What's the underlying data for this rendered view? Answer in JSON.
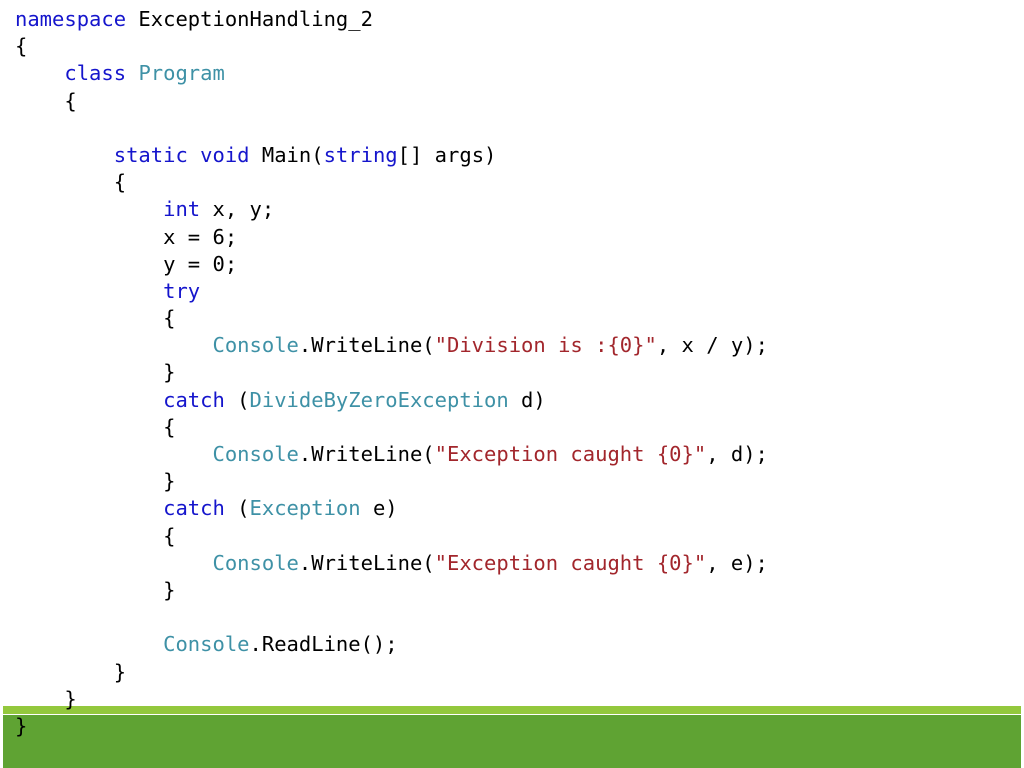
{
  "slide": {
    "kind": "code-slide",
    "background_color": "#FFFFFF",
    "footer": {
      "accent_color": "#93C83D",
      "main_color": "#5FA333"
    }
  },
  "syntax_colors": {
    "keyword": "#1515CC",
    "type": "#3E91A6",
    "string": "#A2262C",
    "plain": "#000000"
  },
  "code": {
    "language": "C#",
    "lines": [
      {
        "id": "l1",
        "indent": 0,
        "tokens": [
          {
            "t": "namespace",
            "c": "kw"
          },
          {
            "t": " ExceptionHandling_2",
            "c": "pl"
          }
        ]
      },
      {
        "id": "l2",
        "indent": 0,
        "tokens": [
          {
            "t": "{",
            "c": "pl"
          }
        ]
      },
      {
        "id": "l3",
        "indent": 1,
        "tokens": [
          {
            "t": "class",
            "c": "kw"
          },
          {
            "t": " ",
            "c": "pl"
          },
          {
            "t": "Program",
            "c": "type"
          }
        ]
      },
      {
        "id": "l4",
        "indent": 1,
        "tokens": [
          {
            "t": "{",
            "c": "pl"
          }
        ]
      },
      {
        "id": "l5",
        "indent": 0,
        "tokens": [
          {
            "t": "",
            "c": "pl"
          }
        ]
      },
      {
        "id": "l6",
        "indent": 2,
        "tokens": [
          {
            "t": "static void",
            "c": "kw"
          },
          {
            "t": " Main(",
            "c": "pl"
          },
          {
            "t": "string",
            "c": "kw"
          },
          {
            "t": "[] args)",
            "c": "pl"
          }
        ]
      },
      {
        "id": "l7",
        "indent": 2,
        "tokens": [
          {
            "t": "{",
            "c": "pl"
          }
        ]
      },
      {
        "id": "l8",
        "indent": 3,
        "tokens": [
          {
            "t": "int",
            "c": "kw"
          },
          {
            "t": " x, y;",
            "c": "pl"
          }
        ]
      },
      {
        "id": "l9",
        "indent": 3,
        "tokens": [
          {
            "t": "x = 6;",
            "c": "pl"
          }
        ]
      },
      {
        "id": "l10",
        "indent": 3,
        "tokens": [
          {
            "t": "y = 0;",
            "c": "pl"
          }
        ]
      },
      {
        "id": "l11",
        "indent": 3,
        "tokens": [
          {
            "t": "try",
            "c": "kw"
          }
        ]
      },
      {
        "id": "l12",
        "indent": 3,
        "tokens": [
          {
            "t": "{",
            "c": "pl"
          }
        ]
      },
      {
        "id": "l13",
        "indent": 4,
        "tokens": [
          {
            "t": "Console",
            "c": "type"
          },
          {
            "t": ".WriteLine(",
            "c": "pl"
          },
          {
            "t": "\"Division is :{0}\"",
            "c": "str"
          },
          {
            "t": ", x / y);",
            "c": "pl"
          }
        ]
      },
      {
        "id": "l14",
        "indent": 3,
        "tokens": [
          {
            "t": "}",
            "c": "pl"
          }
        ]
      },
      {
        "id": "l15",
        "indent": 3,
        "tokens": [
          {
            "t": "catch",
            "c": "kw"
          },
          {
            "t": " (",
            "c": "pl"
          },
          {
            "t": "DivideByZeroException",
            "c": "type"
          },
          {
            "t": " d)",
            "c": "pl"
          }
        ]
      },
      {
        "id": "l16",
        "indent": 3,
        "tokens": [
          {
            "t": "{",
            "c": "pl"
          }
        ]
      },
      {
        "id": "l17",
        "indent": 4,
        "tokens": [
          {
            "t": "Console",
            "c": "type"
          },
          {
            "t": ".WriteLine(",
            "c": "pl"
          },
          {
            "t": "\"Exception caught {0}\"",
            "c": "str"
          },
          {
            "t": ", d);",
            "c": "pl"
          }
        ]
      },
      {
        "id": "l18",
        "indent": 3,
        "tokens": [
          {
            "t": "}",
            "c": "pl"
          }
        ]
      },
      {
        "id": "l19",
        "indent": 3,
        "tokens": [
          {
            "t": "catch",
            "c": "kw"
          },
          {
            "t": " (",
            "c": "pl"
          },
          {
            "t": "Exception",
            "c": "type"
          },
          {
            "t": " e)",
            "c": "pl"
          }
        ]
      },
      {
        "id": "l20",
        "indent": 3,
        "tokens": [
          {
            "t": "{",
            "c": "pl"
          }
        ]
      },
      {
        "id": "l21",
        "indent": 4,
        "tokens": [
          {
            "t": "Console",
            "c": "type"
          },
          {
            "t": ".WriteLine(",
            "c": "pl"
          },
          {
            "t": "\"Exception caught {0}\"",
            "c": "str"
          },
          {
            "t": ", e);",
            "c": "pl"
          }
        ]
      },
      {
        "id": "l22",
        "indent": 3,
        "tokens": [
          {
            "t": "}",
            "c": "pl"
          }
        ]
      },
      {
        "id": "l23",
        "indent": 0,
        "tokens": [
          {
            "t": "",
            "c": "pl"
          }
        ]
      },
      {
        "id": "l24",
        "indent": 3,
        "tokens": [
          {
            "t": "Console",
            "c": "type"
          },
          {
            "t": ".ReadLine();",
            "c": "pl"
          }
        ]
      },
      {
        "id": "l25",
        "indent": 2,
        "tokens": [
          {
            "t": "}",
            "c": "pl"
          }
        ]
      },
      {
        "id": "l26",
        "indent": 1,
        "tokens": [
          {
            "t": "}",
            "c": "pl"
          }
        ]
      },
      {
        "id": "l27",
        "indent": 0,
        "tokens": [
          {
            "t": "}",
            "c": "pl"
          }
        ]
      }
    ]
  }
}
